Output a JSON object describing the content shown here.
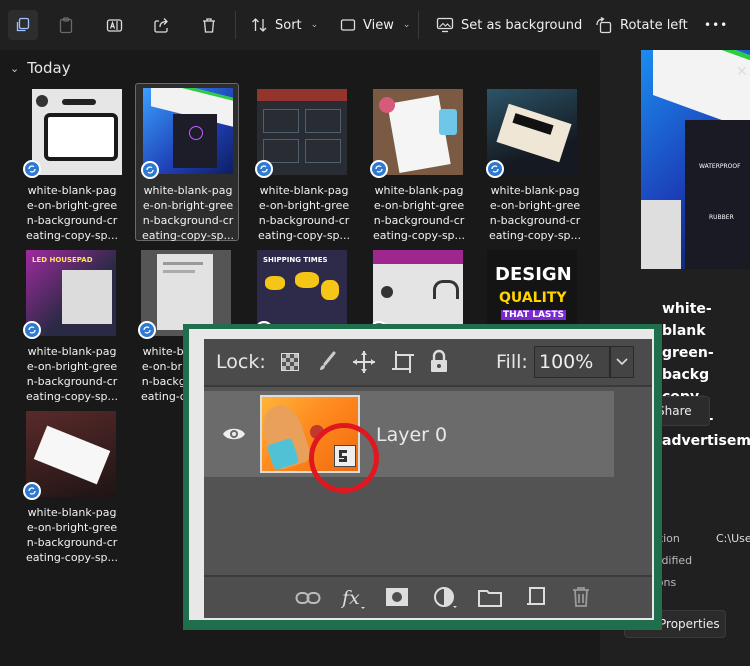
{
  "toolbar": {
    "sort_label": "Sort",
    "view_label": "View",
    "set_background_label": "Set as background",
    "rotate_left_label": "Rotate left",
    "more_label": "•••"
  },
  "gallery": {
    "group_label": "Today",
    "filename_caption": "white-blank-pag\ne-on-bright-gree\nn-background-cr\neating-copy-sp..."
  },
  "details": {
    "title": "white-blank\ngreen-backg\ncopy-space-\nadvertiseme",
    "share_label": "Share",
    "location_label": "cation",
    "location_value": "C:\\Use",
    "modified_label": "modified",
    "dimensions_label": "sions",
    "properties_label": "Properties",
    "preview_text_1": "WATERPROOF",
    "preview_text_2": "RUBBER"
  },
  "thumb_texts": {
    "led": "LED HOUSEPAD",
    "shipping": "SHIPPING TIMES",
    "design": "DESIGN",
    "quality": "QUALITY",
    "lasts": "THAT LASTS"
  },
  "photoshop": {
    "lock_label": "Lock:",
    "fill_label": "Fill:",
    "fill_value": "100%",
    "layer_name": "Layer 0"
  },
  "colors": {
    "accent": "#2f7ad1",
    "annotation_red": "#e0171f",
    "frame_green": "#1f6e4c"
  }
}
